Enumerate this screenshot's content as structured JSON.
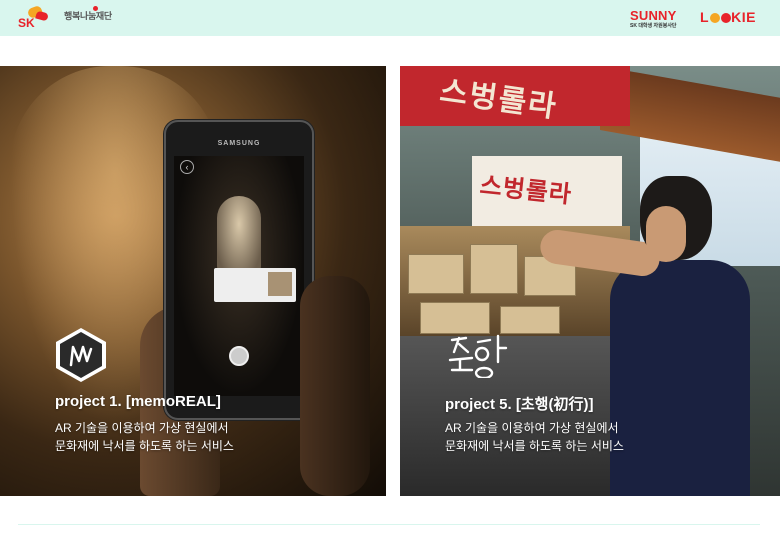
{
  "header": {
    "sk_logo_text": "SK",
    "foundation_name": "행복나눔재단",
    "partner_1": {
      "name": "SUNNY",
      "subtitle": "SK 대학생 자원봉사단"
    },
    "partner_2": {
      "name_parts": [
        "L",
        "K",
        "IE"
      ]
    },
    "background_color": "#d9f6ee"
  },
  "projects": [
    {
      "title": "project 1. [memoREAL]",
      "description_lines": [
        "AR 기술을 이용하여 가상 현실에서",
        "문화재에 낙서를 하도록 하는 서비스"
      ],
      "logo_icon": "memoreal-hexagon-icon",
      "phone": {
        "brand": "SAMSUNG"
      }
    },
    {
      "title": "project 5. [초행(初行)]",
      "description_lines": [
        "AR 기술을 이용하여 가상 현실에서",
        "문화재에 낙서를 하도록 하는 서비스"
      ],
      "logo_icon": "chohaeng-handwritten-icon",
      "signs": [
        "스벙롤라",
        "스벙롤라"
      ]
    }
  ],
  "colors": {
    "accent_red": "#e8232a",
    "accent_orange": "#f5a623",
    "header_bg": "#d9f6ee"
  }
}
